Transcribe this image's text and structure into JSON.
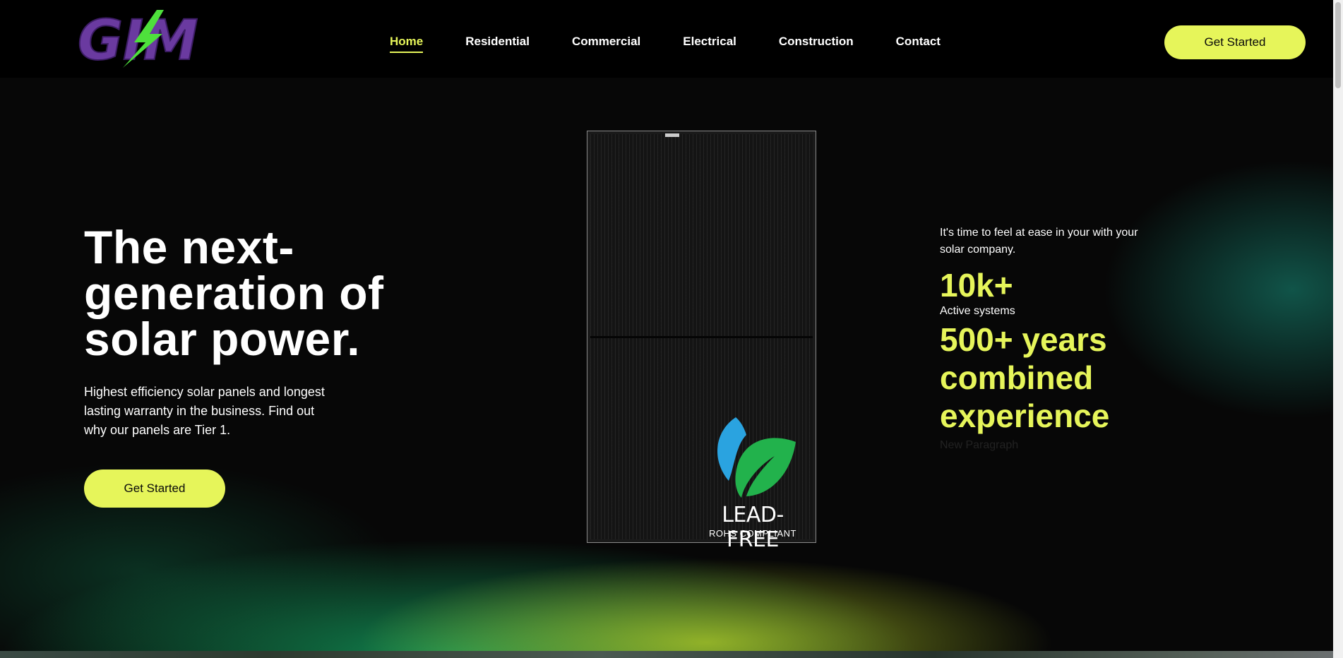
{
  "brand": {
    "logo_text": "GIM"
  },
  "nav": {
    "items": [
      {
        "label": "Home",
        "active": true
      },
      {
        "label": "Residential",
        "active": false
      },
      {
        "label": "Commercial",
        "active": false
      },
      {
        "label": "Electrical",
        "active": false
      },
      {
        "label": "Construction",
        "active": false
      },
      {
        "label": "Contact",
        "active": false
      }
    ],
    "cta_label": "Get Started"
  },
  "hero": {
    "title": "The next-generation of solar power.",
    "description": "Highest efficiency solar panels and longest lasting warranty in the business. Find out why our panels are Tier 1.",
    "cta_label": "Get Started"
  },
  "panel": {
    "badge_title": "LEAD-FREE",
    "badge_subtitle": "ROHS COMPLIANT",
    "icon": "leaf-icon"
  },
  "stats": {
    "intro": "It's time to feel at ease in your with your solar company.",
    "items": [
      {
        "value": "10k+",
        "label": "Active systems"
      },
      {
        "value": "500+ years combined experience",
        "label": "New Paragraph"
      }
    ]
  },
  "colors": {
    "accent": "#e6f55a",
    "background": "#050505",
    "logo_purple": "#6a3aa0",
    "logo_green": "#4ee03c"
  }
}
